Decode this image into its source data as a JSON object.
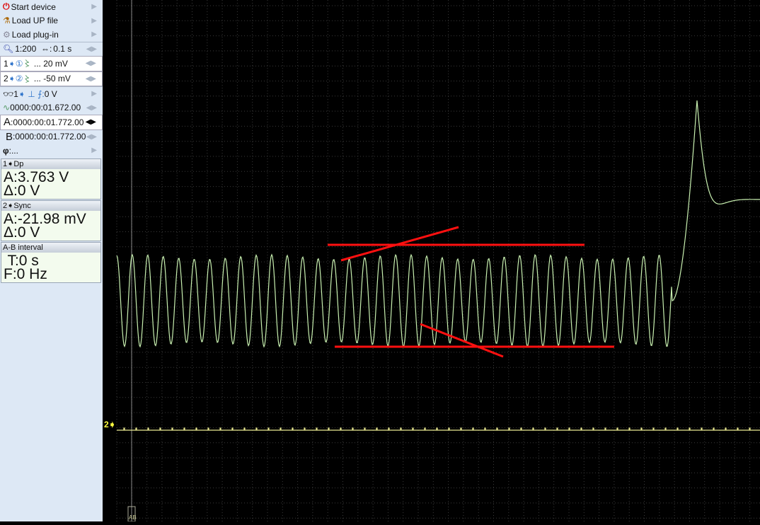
{
  "menu": [
    {
      "label": "Start device",
      "icon": "power-icon"
    },
    {
      "label": "Load UP file",
      "icon": "load-file-icon"
    },
    {
      "label": "Load plug-in",
      "icon": "plugin-icon"
    }
  ],
  "zoom": {
    "ratio": "1:200",
    "timebase": "0.1 s"
  },
  "channels": [
    {
      "num": "1",
      "scale": "... 20 mV"
    },
    {
      "num": "2",
      "scale": "... -50 mV"
    }
  ],
  "trigger": {
    "channel": "1",
    "level": "0 V"
  },
  "trigger_time": "0000:00:01.672.00",
  "cursor_a": {
    "label": "A",
    "time": "0000:00:01.772.00"
  },
  "cursor_b": {
    "label": "B",
    "time": "0000:00:01.772.00"
  },
  "phase": {
    "label": "φ",
    "value": "..."
  },
  "meas": [
    {
      "title": "1➧Dp",
      "a": "A:3.763 V",
      "d": "Δ:0 V"
    },
    {
      "title": "2➧Sync",
      "a": "A:-21.98 mV",
      "d": "Δ:0 V"
    },
    {
      "title": "A-B interval",
      "a": " T:0 s",
      "d": "F:0 Hz"
    }
  ],
  "scope": {
    "ch2_marker": "2➧",
    "cursor_marker": "AB",
    "colors": {
      "ch1": "#c8f0b0",
      "ch2": "#e8e890",
      "annot": "#ff1010"
    }
  }
}
